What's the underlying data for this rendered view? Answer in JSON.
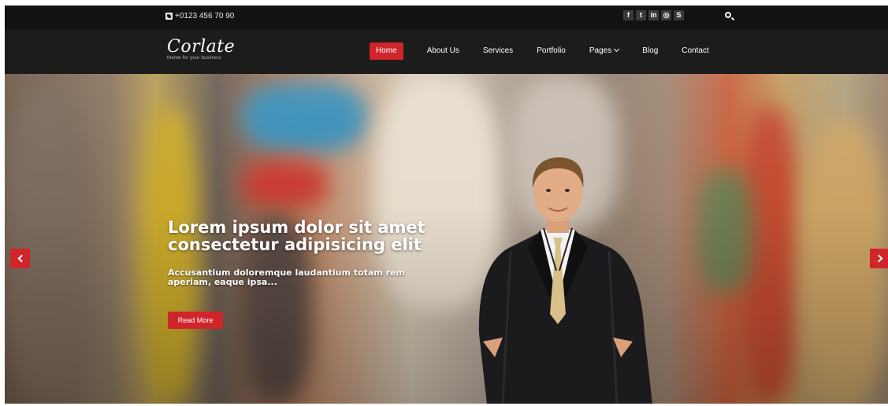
{
  "topbar": {
    "phone": "+0123 456 70 90",
    "social_icons": [
      {
        "name": "facebook-icon",
        "glyph": "f"
      },
      {
        "name": "twitter-icon",
        "glyph": "t"
      },
      {
        "name": "linkedin-icon",
        "glyph": "in"
      },
      {
        "name": "dribbble-icon",
        "glyph": "◎"
      },
      {
        "name": "skype-icon",
        "glyph": "S"
      }
    ]
  },
  "brand": {
    "logo": "Corlate",
    "tagline": "theme for your business"
  },
  "nav": {
    "items": [
      "Home",
      "About Us",
      "Services",
      "Portfolio",
      "Pages",
      "Blog",
      "Contact"
    ],
    "active": "Home"
  },
  "hero": {
    "title": "Lorem ipsum dolor sit amet consectetur adipisicing elit",
    "subtitle": "Accusantium doloremque laudantium totam rem aperiam, eaque ipsa...",
    "button": "Read More"
  },
  "colors": {
    "accent": "#d0252a",
    "topbar": "#121212",
    "navbar": "#1c1c1c"
  }
}
